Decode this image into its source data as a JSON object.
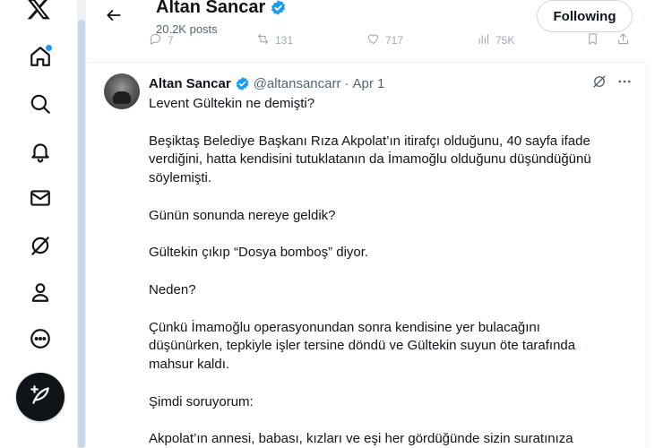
{
  "header": {
    "name": "Altan Sancar",
    "posts": "20.2K posts",
    "follow_label": "Following"
  },
  "peek_actions": {
    "replies": "7",
    "reposts": "131",
    "likes": "717",
    "views": "75K"
  },
  "tweet": {
    "author": "Altan Sancar",
    "handle": "@altansancarr",
    "separator": "·",
    "date": "Apr 1",
    "lines": [
      "Levent Gültekin ne demişti?",
      "",
      "Beşiktaş Belediye Başkanı Rıza Akpolat’ın itirafçı olduğunu, 40 sayfa ifade",
      "verdiğini, hatta kendisini tutuklatanın da İmamoğlu olduğunu düşündüğünü",
      "söylemişti.",
      "",
      "Günün sonunda nereye geldik?",
      "",
      "Gültekin çıkıp “Dosya bomboş” diyor.",
      "",
      "Neden?",
      "",
      "Çünkü İmamoğlu operasyonundan sonra kendisine yer bulacağını",
      "düşünürken, tepkiyle işler tersine döndü ve Gültekin suyun öte tarafında",
      "mahsur kaldı.",
      "",
      "Şimdi soruyorum:",
      "",
      "Akpolat’ın annesi, babası, kızları ve eşi her gördüğünde sizin suratınıza"
    ]
  },
  "nav": {
    "icons": [
      "x-logo-icon",
      "home-icon",
      "search-icon",
      "notifications-icon",
      "messages-icon",
      "grok-icon",
      "profile-icon",
      "more-icon",
      "post-compose-icon"
    ]
  },
  "colors": {
    "text": "#0f1419",
    "muted": "#536471",
    "accent": "#1d9bf0",
    "border": "#eff3f4"
  }
}
